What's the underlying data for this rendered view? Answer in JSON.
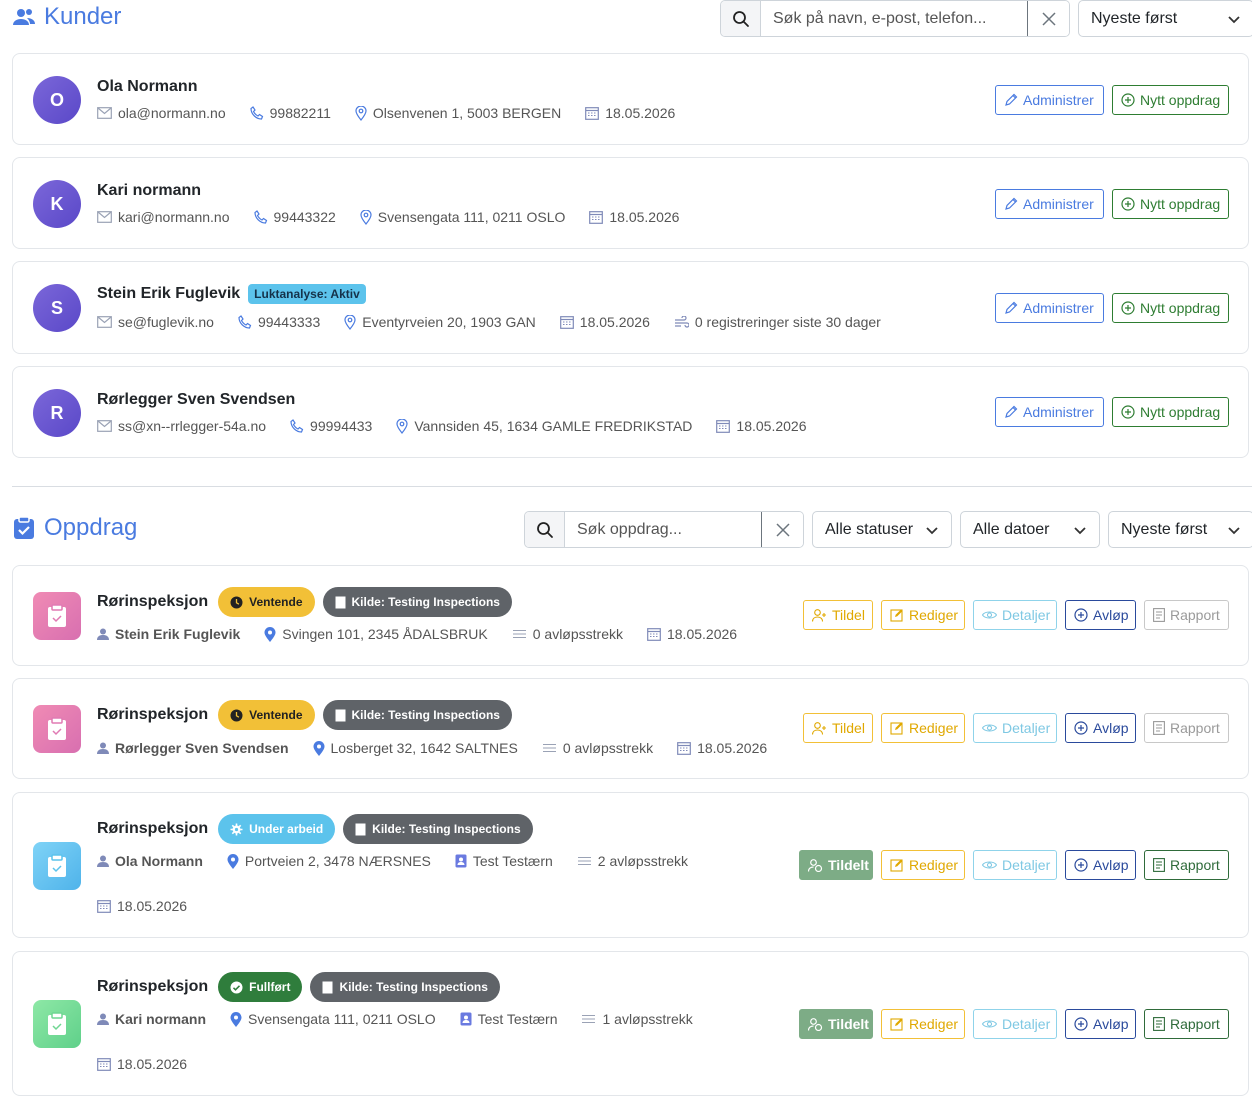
{
  "kunder": {
    "title": "Kunder",
    "search_placeholder": "Søk på navn, e-post, telefon...",
    "sort_label": "Nyeste først",
    "customers": [
      {
        "initial": "O",
        "name": "Ola Normann",
        "email": "ola@normann.no",
        "phone": "99882211",
        "address": "Olsenvenen 1, 5003 BERGEN",
        "date": "18.05.2026"
      },
      {
        "initial": "K",
        "name": "Kari normann",
        "email": "kari@normann.no",
        "phone": "99443322",
        "address": "Svensengata 111, 0211 OSLO",
        "date": "18.05.2026"
      },
      {
        "initial": "S",
        "name": "Stein Erik Fuglevik",
        "badge": "Luktanalyse: Aktiv",
        "email": "se@fuglevik.no",
        "phone": "99443333",
        "address": "Eventyrveien 20, 1903 GAN",
        "date": "18.05.2026",
        "registrations": "0 registreringer siste 30 dager"
      },
      {
        "initial": "R",
        "name": "Rørlegger Sven Svendsen",
        "email": "ss@xn--rrlegger-54a.no",
        "phone": "99994433",
        "address": "Vannsiden 45, 1634 GAMLE FREDRIKSTAD",
        "date": "18.05.2026"
      }
    ],
    "administrer_label": "Administrer",
    "nytt_oppdrag_label": "Nytt oppdrag"
  },
  "oppdrag": {
    "title": "Oppdrag",
    "search_placeholder": "Søk oppdrag...",
    "status_filter": "Alle statuser",
    "date_filter": "Alle datoer",
    "sort_label": "Nyeste først",
    "buttons": {
      "tildel": "Tildel",
      "tildelt": "Tildelt",
      "rediger": "Rediger",
      "detaljer": "Detaljer",
      "avlop": "Avløp",
      "rapport": "Rapport"
    },
    "tasks": [
      {
        "title": "Rørinspeksjon",
        "status": "Ventende",
        "source": "Kilde: Testing Inspections",
        "customer": "Stein Erik Fuglevik",
        "address": "Svingen 101, 2345 ÅDALSBRUK",
        "strekk": "0 avløpsstrekk",
        "date": "18.05.2026"
      },
      {
        "title": "Rørinspeksjon",
        "status": "Ventende",
        "source": "Kilde: Testing Inspections",
        "customer": "Rørlegger Sven Svendsen",
        "address": "Losberget 32, 1642 SALTNES",
        "strekk": "0 avløpsstrekk",
        "date": "18.05.2026"
      },
      {
        "title": "Rørinspeksjon",
        "status": "Under arbeid",
        "source": "Kilde: Testing Inspections",
        "customer": "Ola Normann",
        "address": "Portveien 2, 3478 NÆRSNES",
        "assignee": "Test Testærn",
        "strekk": "2 avløpsstrekk",
        "date": "18.05.2026"
      },
      {
        "title": "Rørinspeksjon",
        "status": "Fullført",
        "source": "Kilde: Testing Inspections",
        "customer": "Kari normann",
        "address": "Svensengata 111, 0211 OSLO",
        "assignee": "Test Testærn",
        "strekk": "1 avløpsstrekk",
        "date": "18.05.2026"
      }
    ]
  },
  "colors": {
    "accent": "#4a7be0",
    "ventende": "#f2c037",
    "under_arbeid": "#5cc3ec",
    "fullfort": "#2f7d3c",
    "kilde": "#5f6368"
  }
}
